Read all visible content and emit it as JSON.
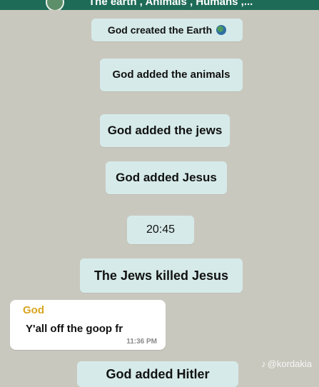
{
  "header": {
    "subtitle": "The earth , Animals , Humans ,..."
  },
  "messages": [
    {
      "text": "God created the Earth",
      "icon": "globe-icon"
    },
    {
      "text": "God added the animals"
    },
    {
      "text": "God added the jews"
    },
    {
      "text": "God added Jesus"
    },
    {
      "text": "20:45"
    },
    {
      "text": "The Jews killed Jesus"
    }
  ],
  "incoming": {
    "sender": "God",
    "text": "Y'all off the goop fr",
    "time": "11:36 PM"
  },
  "last_message": {
    "text": "God added Hitler"
  },
  "watermark": {
    "text": "@kordakia"
  },
  "colors": {
    "header": "#1e6b57",
    "background": "#c9c8bf",
    "system_bubble": "#d6ebe9",
    "sender_name": "#d9a520"
  }
}
